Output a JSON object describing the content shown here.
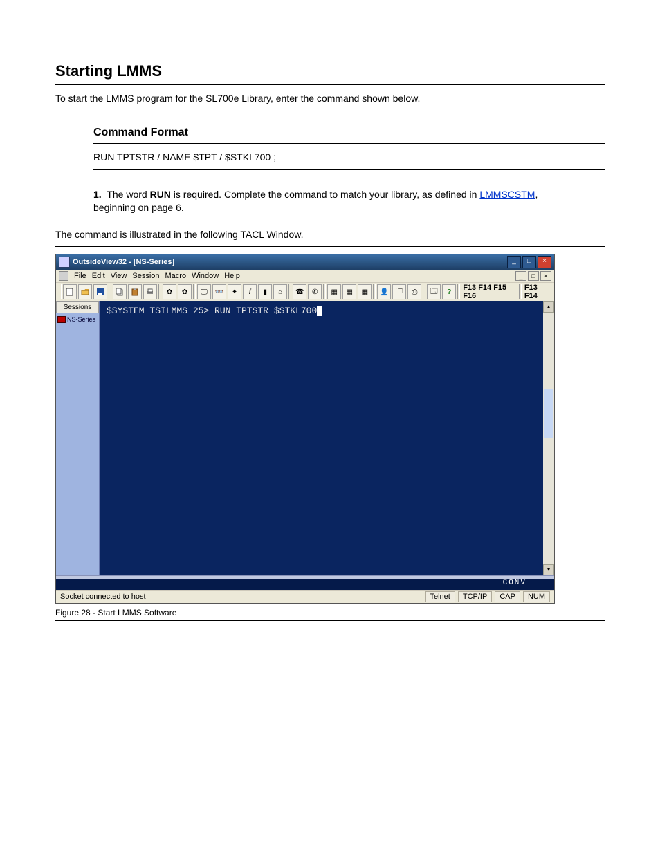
{
  "doc": {
    "start_lmms": {
      "heading": "Starting LMMS",
      "intro": "To start the LMMS program for the SL700e Library, enter the command shown below."
    },
    "tacl_command": {
      "heading": "Command Format",
      "rule_line": "RUN TPTSTR / NAME $TPT / $STKL700 ;",
      "note_index": "1.",
      "note_text_pre": "The word ",
      "note_bold": "RUN",
      "note_text_post": " is required. Complete the command to match your library, as defined in ",
      "note_link": "LMMSCSTM",
      "note_after_link": ", beginning on page 6.",
      "illustrated": "The command is illustrated in the following TACL Window."
    },
    "figure": {
      "caption": "Figure 28 - Start LMMS Software"
    }
  },
  "screenshot": {
    "title": "OutsideView32 - [NS-Series]",
    "menu": {
      "file": "File",
      "edit": "Edit",
      "view": "View",
      "session": "Session",
      "macro": "Macro",
      "window": "Window",
      "help": "Help"
    },
    "toolbar_text_right1": "F13 F14 F15 F16",
    "toolbar_text_right2": "F13 F14",
    "sessions_panel": {
      "tab": "Sessions",
      "item": "NS-Series"
    },
    "terminal": {
      "prompt": "$SYSTEM TSILMMS 25> RUN TPTSTR $STKL700"
    },
    "conv": "CONV",
    "status": {
      "text": "Socket connected to host",
      "col1": "Telnet",
      "col2": "TCP/IP",
      "col3": "CAP",
      "col4": "NUM"
    }
  }
}
